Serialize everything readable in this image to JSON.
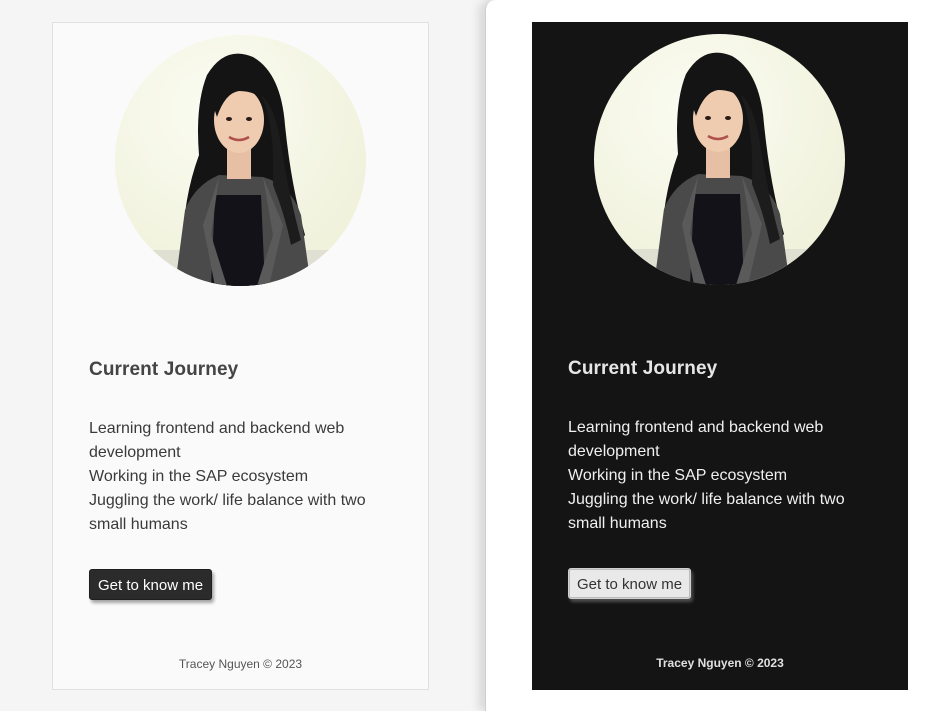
{
  "light_card": {
    "heading": "Current Journey",
    "lines": [
      "Learning frontend and backend web development",
      "Working in the SAP ecosystem",
      "Juggling the work/ life balance with two small humans"
    ],
    "button_label": "Get to know me",
    "footer": "Tracey Nguyen © 2023"
  },
  "dark_card": {
    "heading": "Current Journey",
    "lines": [
      "Learning frontend and backend web development",
      "Working in the SAP ecosystem",
      "Juggling the work/ life balance with two small humans"
    ],
    "button_label": "Get to know me",
    "footer": "Tracey Nguyen © 2023"
  },
  "colors": {
    "light_card_bg": "#fafafa",
    "dark_card_bg": "#141414",
    "light_button_bg": "#2b2b2b",
    "dark_button_bg": "#e9e9e9"
  }
}
